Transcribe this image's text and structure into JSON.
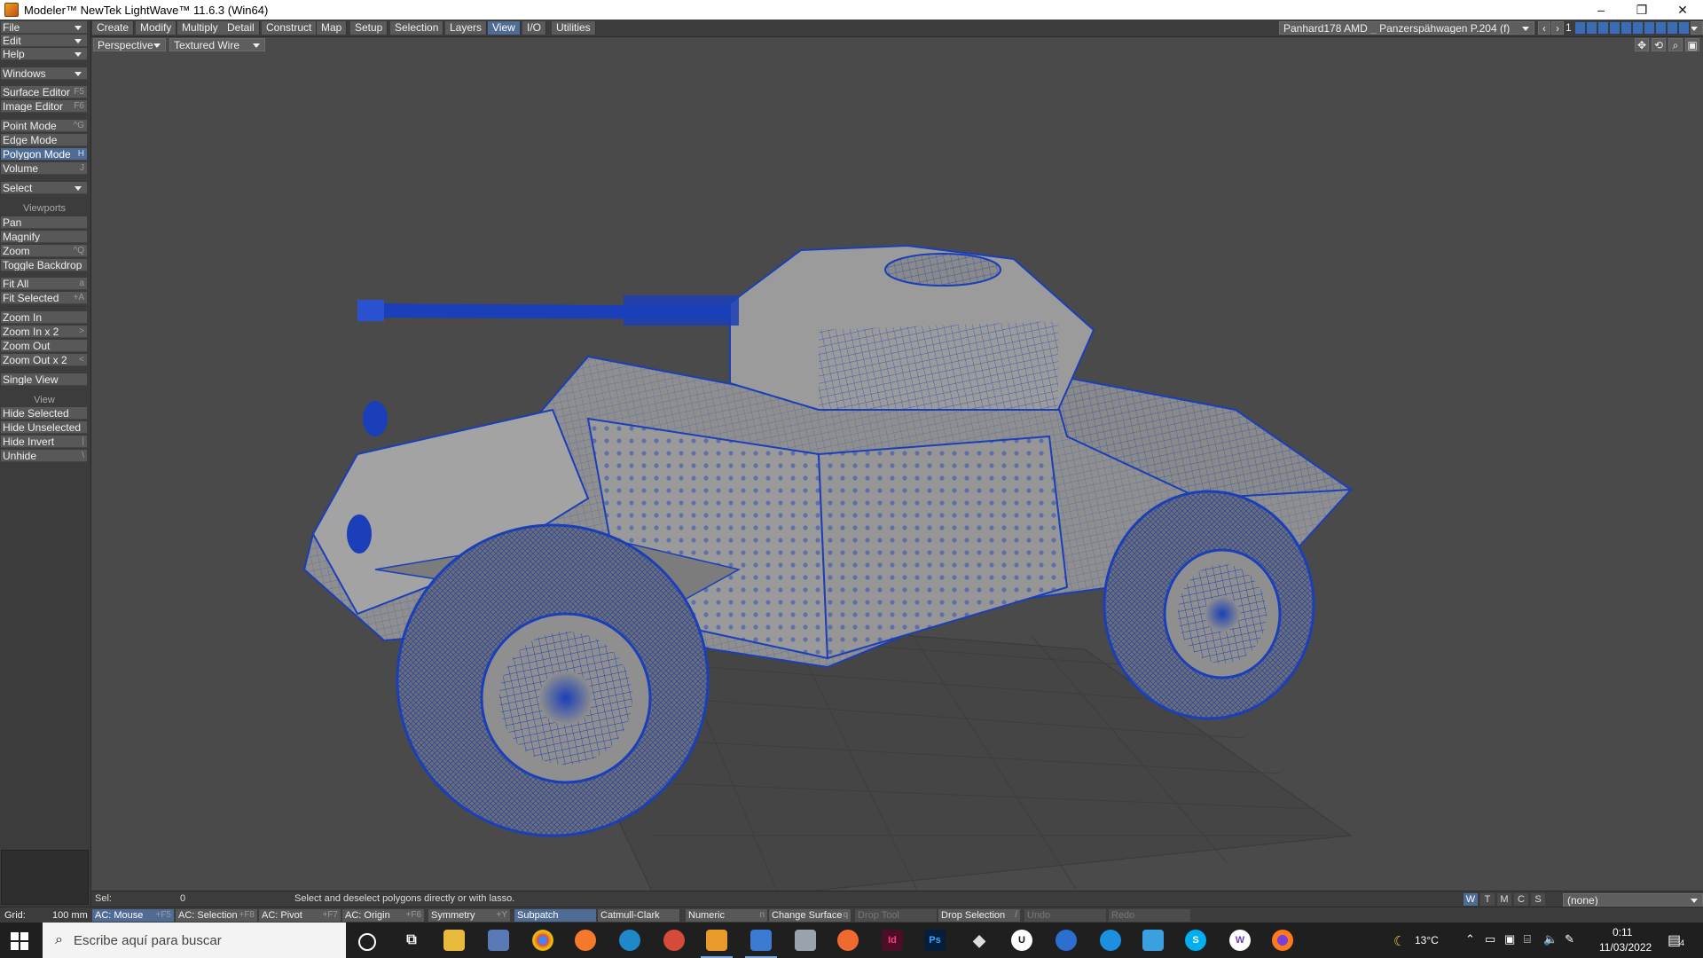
{
  "window": {
    "title": "Modeler™ NewTek LightWave™ 11.6.3 (Win64)",
    "controls": [
      "–",
      "❐",
      "✕"
    ]
  },
  "menu_tabs": [
    "Create",
    "Modify",
    "Multiply",
    "Detail",
    "Construct",
    "Map",
    "Setup",
    "Selection",
    "Layers",
    "View",
    "I/O",
    "Utilities"
  ],
  "active_tab": "View",
  "object_selector": "Panhard178 AMD _ Panzerspähwagen P.204 (f)",
  "layer_number": "1",
  "sidebar": {
    "file": "File",
    "edit": "Edit",
    "help": "Help",
    "windows": "Windows",
    "surface_editor": "Surface Editor",
    "surface_editor_key": "F5",
    "image_editor": "Image Editor",
    "image_editor_key": "F6",
    "point_mode": "Point Mode",
    "point_mode_key": "^G",
    "edge_mode": "Edge Mode",
    "polygon_mode": "Polygon Mode",
    "polygon_mode_key": "H",
    "volume": "Volume",
    "volume_key": "J",
    "select": "Select",
    "viewports_header": "Viewports",
    "pan": "Pan",
    "magnify": "Magnify",
    "zoom": "Zoom",
    "zoom_key": "^Q",
    "toggle_backdrop": "Toggle Backdrop",
    "fit_all": "Fit All",
    "fit_all_key": "a",
    "fit_selected": "Fit Selected",
    "fit_selected_key": "+A",
    "zoom_in": "Zoom In",
    "zoom_in_x2": "Zoom In x 2",
    "zoom_in_x2_key": ">",
    "zoom_out": "Zoom Out",
    "zoom_out_x2": "Zoom Out x 2",
    "zoom_out_x2_key": "<",
    "single_view": "Single View",
    "view_header": "View",
    "hide_selected": "Hide Selected",
    "hide_unselected": "Hide Unselected",
    "hide_invert": "Hide Invert",
    "hide_invert_key": "|",
    "unhide": "Unhide",
    "unhide_key": "\\"
  },
  "viewport": {
    "projection": "Perspective",
    "render_mode": "Textured Wire",
    "colors": {
      "background": "#4a4a4a",
      "wire": "#1a3fb8",
      "body": "#8f8f8f"
    }
  },
  "infobar": {
    "sel_label": "Sel:",
    "sel_value": "0",
    "hint": "Select and deselect polygons directly or with lasso.",
    "wtmcs": [
      "W",
      "T",
      "M",
      "C",
      "S"
    ],
    "surface_dropdown": "(none)"
  },
  "bottombar": {
    "grid_label": "Grid:",
    "grid_value": "100 mm",
    "ac_mouse": "AC: Mouse",
    "ac_mouse_key": "+F5",
    "ac_selection": "AC: Selection",
    "ac_selection_key": "+F8",
    "ac_pivot": "AC: Pivot",
    "ac_pivot_key": "+F7",
    "ac_origin": "AC: Origin",
    "ac_origin_key": "+F6",
    "symmetry": "Symmetry",
    "symmetry_key": "+Y",
    "subpatch": "Subpatch",
    "catmull": "Catmull-Clark",
    "numeric": "Numeric",
    "numeric_key": "n",
    "change_surface": "Change Surface",
    "change_surface_key": "q",
    "drop_tool": "Drop Tool",
    "drop_selection": "Drop Selection",
    "drop_selection_key": "/",
    "undo": "Undo",
    "redo": "Redo"
  },
  "taskbar": {
    "search_placeholder": "Escribe aquí para buscar",
    "apps": [
      "cortana",
      "task-view",
      "file-explorer",
      "calculator",
      "chrome",
      "blender",
      "browser",
      "app-red",
      "lightwave-layout",
      "lightwave-modeler",
      "image-viewer",
      "firefox-dev",
      "indesign",
      "photoshop",
      "unity",
      "unreal",
      "app-blue",
      "app-sync",
      "app-window",
      "skype",
      "app-w",
      "firefox"
    ],
    "indesign_label": "Id",
    "photoshop_label": "Ps",
    "unreal_label": "U",
    "skype_label": "S",
    "w_label": "W",
    "temperature": "13°C",
    "time": "0:11",
    "date": "11/03/2022",
    "notification_count": "4"
  }
}
